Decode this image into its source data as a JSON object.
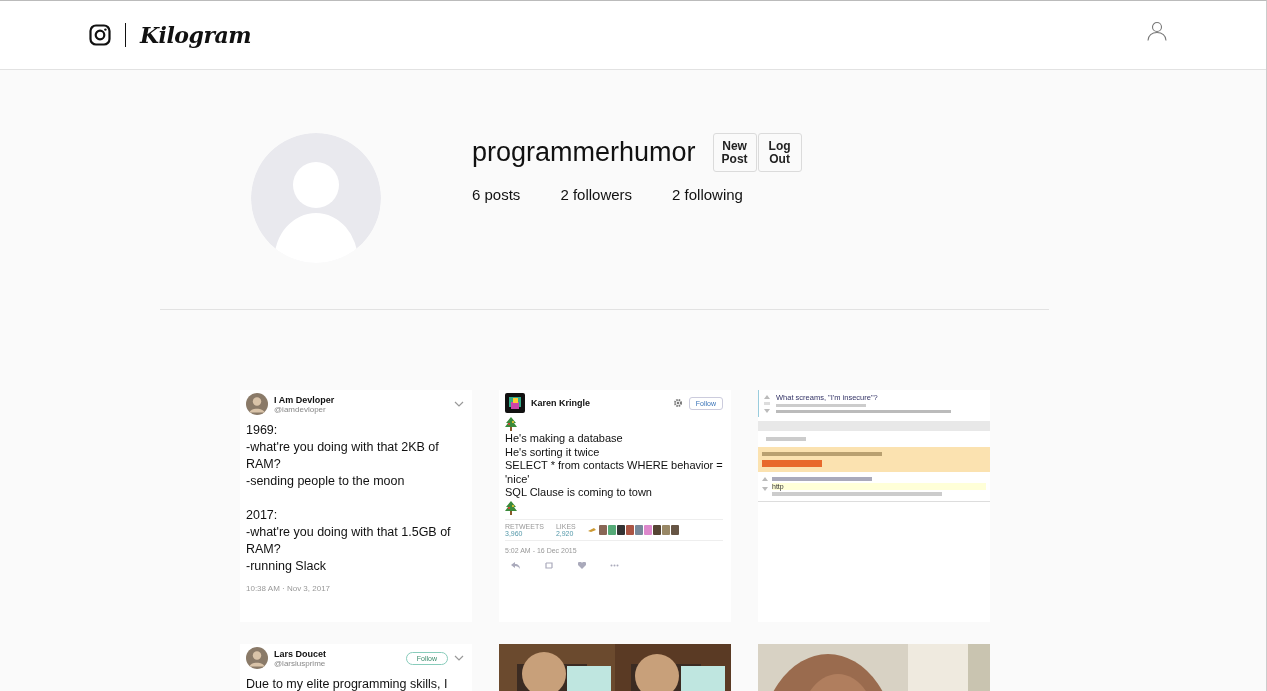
{
  "header": {
    "logo": "Kilogram"
  },
  "profile": {
    "username": "programmerhumor",
    "buttons": [
      "New Post",
      "Log Out"
    ],
    "stats": [
      "6 posts",
      "2 followers",
      "2 following"
    ]
  },
  "posts": [
    {
      "kind": "tweet",
      "author": "I Am Devloper",
      "handle": "@iamdevloper",
      "menu": true,
      "body": [
        {
          "kind": "text",
          "text": "1969:"
        },
        {
          "kind": "text",
          "text": "-what're you doing with that 2KB of RAM?"
        },
        {
          "kind": "text",
          "text": "-sending people to the moon"
        },
        {
          "kind": "gap"
        },
        {
          "kind": "text",
          "text": "2017:"
        },
        {
          "kind": "text",
          "text": "-what're you doing with that 1.5GB of RAM?"
        },
        {
          "kind": "text",
          "text": "-running Slack"
        }
      ],
      "time": "10:38 AM · Nov 3, 2017"
    },
    {
      "kind": "tweet",
      "author": "Karen Kringle",
      "follow": "Follow",
      "gear": true,
      "body": [
        {
          "kind": "tree"
        },
        {
          "kind": "text",
          "text": "He's making a database"
        },
        {
          "kind": "text",
          "text": "He's sorting it twice"
        },
        {
          "kind": "text",
          "text": "SELECT * from contacts WHERE behavior = 'nice'"
        },
        {
          "kind": "text",
          "text": "SQL Clause is coming to town"
        },
        {
          "kind": "tree"
        }
      ],
      "stats": [
        {
          "label": "RETWEETS",
          "value": "3,960"
        },
        {
          "label": "LIKES",
          "value": "2,920"
        }
      ],
      "time": "5:02 AM - 16 Dec 2015",
      "actions": true
    },
    {
      "kind": "reddit",
      "title": "What screams, \"I'm insecure\"?",
      "comment": "http"
    },
    {
      "kind": "tweet",
      "author": "Lars Doucet",
      "handle": "@larsiusprime",
      "follow": "Follow",
      "menu": true,
      "body": [
        {
          "kind": "text",
          "text": "Due to my elite programming skills, I"
        }
      ]
    },
    {
      "kind": "picture"
    },
    {
      "kind": "picture"
    }
  ]
}
